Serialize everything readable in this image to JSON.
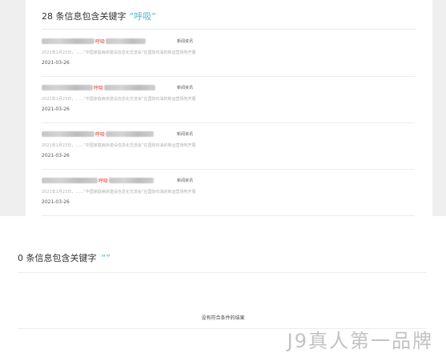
{
  "section1": {
    "heading_prefix": "28 条信息包含关键字",
    "keyword": "“呼吸”"
  },
  "results": [
    {
      "title_highlight": "呼吸",
      "category": "新闻资讯",
      "snippet": "2021年1月23日，……“中国家庭病床建设信息化交流会”在国际石油的新运营场地开展",
      "date": "2021-03-26"
    },
    {
      "title_highlight": "呼吸",
      "category": "新闻资讯",
      "snippet": "2021年1月23日，……“中国家庭病床建设信息化交流会”在国际石油的新运营场地开展",
      "date": "2021-03-26"
    },
    {
      "title_highlight": "呼吸",
      "category": "新闻资讯",
      "snippet": "2021年1月23日，……“中国家庭病床建设信息化交流会”在国际石油的新运营场地开展",
      "date": "2021-03-26"
    },
    {
      "title_highlight": "呼吸",
      "category": "新闻资讯",
      "snippet": "2021年1月23日，……“中国家庭病床建设信息化交流会”在国际石油的新运营场地开展",
      "date": "2021-03-26"
    }
  ],
  "section2": {
    "heading_prefix": "0 条信息包含关键字",
    "keyword": "“”",
    "empty_message": "没有符合条件的结果"
  },
  "watermark": "J9真人第一品牌"
}
